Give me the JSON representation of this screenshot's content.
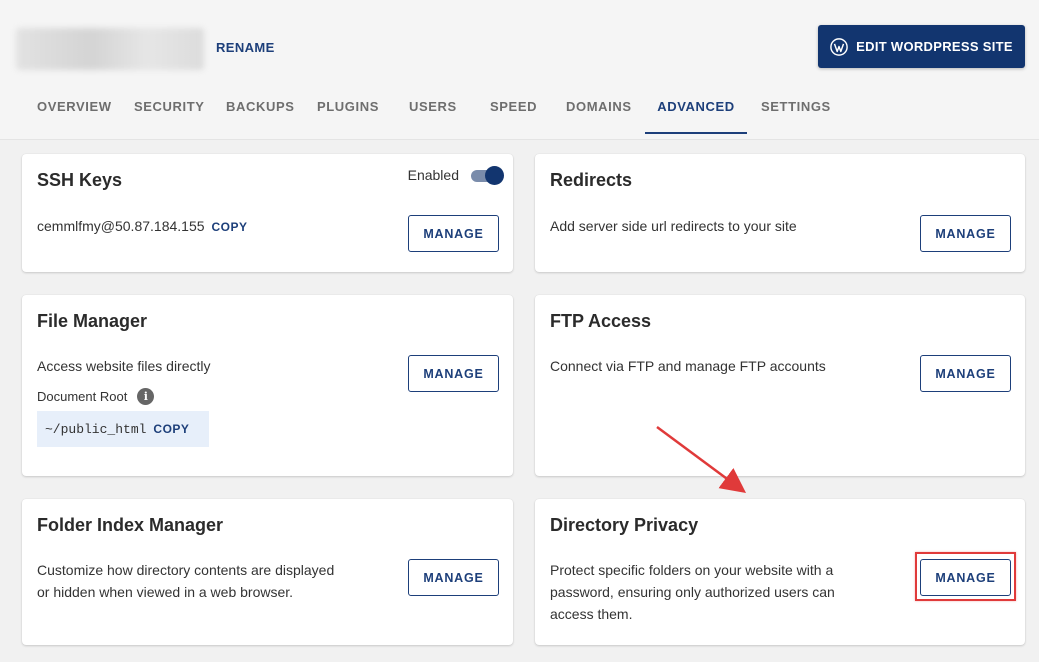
{
  "header": {
    "rename_label": "RENAME",
    "edit_button_label": "EDIT WORDPRESS SITE"
  },
  "tabs": [
    {
      "label": "OVERVIEW"
    },
    {
      "label": "SECURITY"
    },
    {
      "label": "BACKUPS"
    },
    {
      "label": "PLUGINS"
    },
    {
      "label": "USERS"
    },
    {
      "label": "SPEED"
    },
    {
      "label": "DOMAINS"
    },
    {
      "label": "ADVANCED",
      "active": true
    },
    {
      "label": "SETTINGS"
    }
  ],
  "cards": {
    "ssh": {
      "title": "SSH Keys",
      "toggle_label": "Enabled",
      "toggle_on": true,
      "value": "cemmlfmy@50.87.184.155",
      "copy_label": "COPY",
      "button": "MANAGE"
    },
    "redirects": {
      "title": "Redirects",
      "desc": "Add server side url redirects to your site",
      "button": "MANAGE"
    },
    "file_manager": {
      "title": "File Manager",
      "desc": "Access website files directly",
      "docroot_label": "Document Root",
      "path": "~/public_html",
      "copy_label": "COPY",
      "button": "MANAGE"
    },
    "ftp": {
      "title": "FTP Access",
      "desc": "Connect via FTP and manage FTP accounts",
      "button": "MANAGE"
    },
    "folder_index": {
      "title": "Folder Index Manager",
      "desc_line1": "Customize how directory contents are displayed",
      "desc_line2": "or hidden when viewed in a web browser.",
      "button": "MANAGE"
    },
    "directory_privacy": {
      "title": "Directory Privacy",
      "desc_line1": "Protect specific folders on your website with a",
      "desc_line2": "password, ensuring only authorized users can",
      "desc_line3": "access them.",
      "button": "MANAGE"
    }
  },
  "colors": {
    "brand": "#12356f",
    "link": "#1d3f7a",
    "annotation": "#e03a3a",
    "path_bg": "#e7effa"
  },
  "icons": [
    "wordpress-icon",
    "info-icon",
    "arrow-annotation-icon"
  ]
}
